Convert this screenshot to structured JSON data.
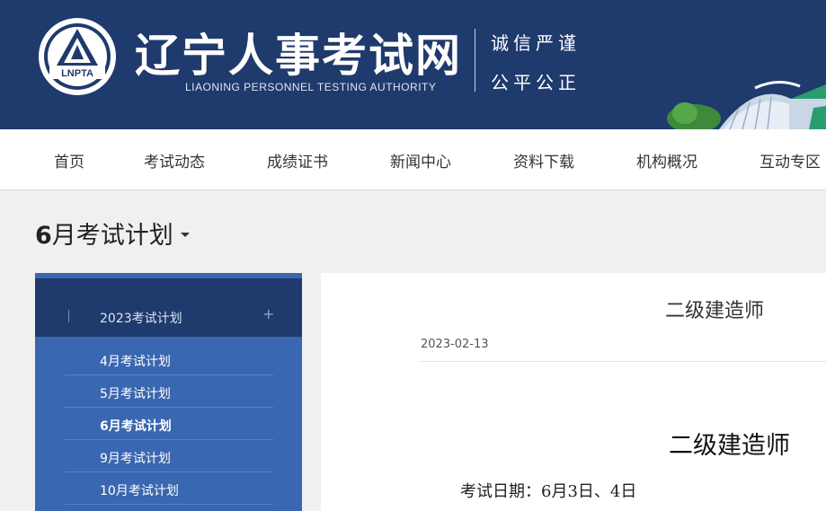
{
  "header": {
    "logo_text": "LNPTA",
    "title": "辽宁人事考试网",
    "subtitle": "LIAONING PERSONNEL TESTING AUTHORITY",
    "slogan_line1": "诚信严谨",
    "slogan_line2": "公平公正"
  },
  "nav": {
    "items": [
      {
        "label": "首页"
      },
      {
        "label": "考试动态"
      },
      {
        "label": "成绩证书"
      },
      {
        "label": "新闻中心"
      },
      {
        "label": "资料下载"
      },
      {
        "label": "机构概况"
      },
      {
        "label": "互动专区"
      }
    ]
  },
  "section": {
    "title_num": "6",
    "title_rest": "月考试计划"
  },
  "sidebar": {
    "group_label": "2023考试计划",
    "group_toggle": "+",
    "items": [
      {
        "label": "4月考试计划",
        "active": false
      },
      {
        "label": "5月考试计划",
        "active": false
      },
      {
        "label": "6月考试计划",
        "active": true
      },
      {
        "label": "9月考试计划",
        "active": false
      },
      {
        "label": "10月考试计划",
        "active": false
      }
    ]
  },
  "article": {
    "title": "二级建造师",
    "date": "2023-02-13",
    "heading": "二级建造师",
    "exam_date_line": "考试日期：6月3日、4日"
  },
  "colors": {
    "header_bg": "#1f3a6c",
    "sidebar_bg": "#3a67b1",
    "sidebar_head_bg": "#1f3a6c"
  }
}
